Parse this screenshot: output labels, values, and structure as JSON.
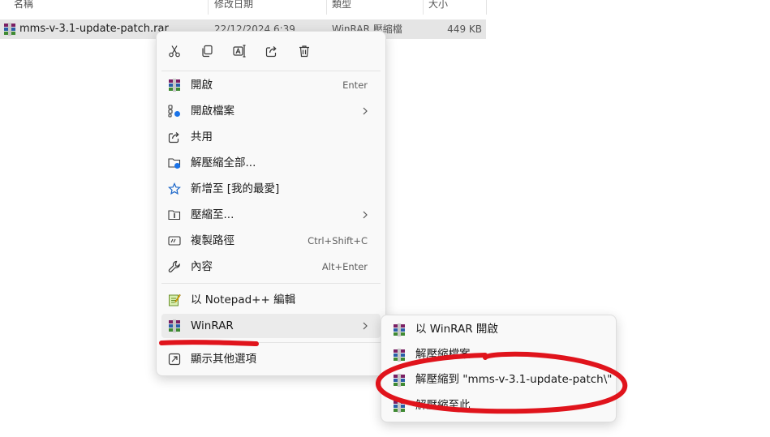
{
  "columns": {
    "name": "名稱",
    "modified": "修改日期",
    "type": "類型",
    "size": "大小"
  },
  "file": {
    "name": "mms-v-3.1-update-patch.rar",
    "modified": "22/12/2024 6:39",
    "type": "WinRAR 壓縮檔",
    "size": "449 KB"
  },
  "toolbar": {
    "icons": [
      "cut-icon",
      "copy-icon",
      "rename-icon",
      "share-icon",
      "delete-icon"
    ]
  },
  "menu": {
    "items": [
      {
        "label": "開啟",
        "shortcut": "Enter",
        "icon": "winrar-icon"
      },
      {
        "label": "開啟檔案",
        "shortcut": "",
        "icon": "open-with-icon",
        "submenu": true
      },
      {
        "label": "共用",
        "shortcut": "",
        "icon": "share-icon"
      },
      {
        "label": "解壓縮全部...",
        "shortcut": "",
        "icon": "extract-all-icon"
      },
      {
        "label": "新增至 [我的最愛]",
        "shortcut": "",
        "icon": "star-icon"
      },
      {
        "label": "壓縮至...",
        "shortcut": "",
        "icon": "compress-icon",
        "submenu": true
      },
      {
        "label": "複製路徑",
        "shortcut": "Ctrl+Shift+C",
        "icon": "copy-path-icon"
      },
      {
        "label": "內容",
        "shortcut": "Alt+Enter",
        "icon": "wrench-icon"
      },
      {
        "label": "以 Notepad++ 編輯",
        "shortcut": "",
        "icon": "notepadpp-icon"
      },
      {
        "label": "WinRAR",
        "shortcut": "",
        "icon": "winrar-icon",
        "submenu": true
      },
      {
        "label": "顯示其他選項",
        "shortcut": "",
        "icon": "more-options-icon"
      }
    ]
  },
  "submenu": {
    "items": [
      {
        "label": "以 WinRAR 開啟"
      },
      {
        "label": "解壓縮檔案..."
      },
      {
        "label": "解壓縮到 \"mms-v-3.1-update-patch\\\""
      },
      {
        "label": "解壓縮至此"
      }
    ]
  },
  "colors": {
    "menu_bg": "#f9f9f9",
    "highlight": "#ebebeb",
    "annotation_red": "#e0141c",
    "selection_row": "#e5e5e5"
  }
}
